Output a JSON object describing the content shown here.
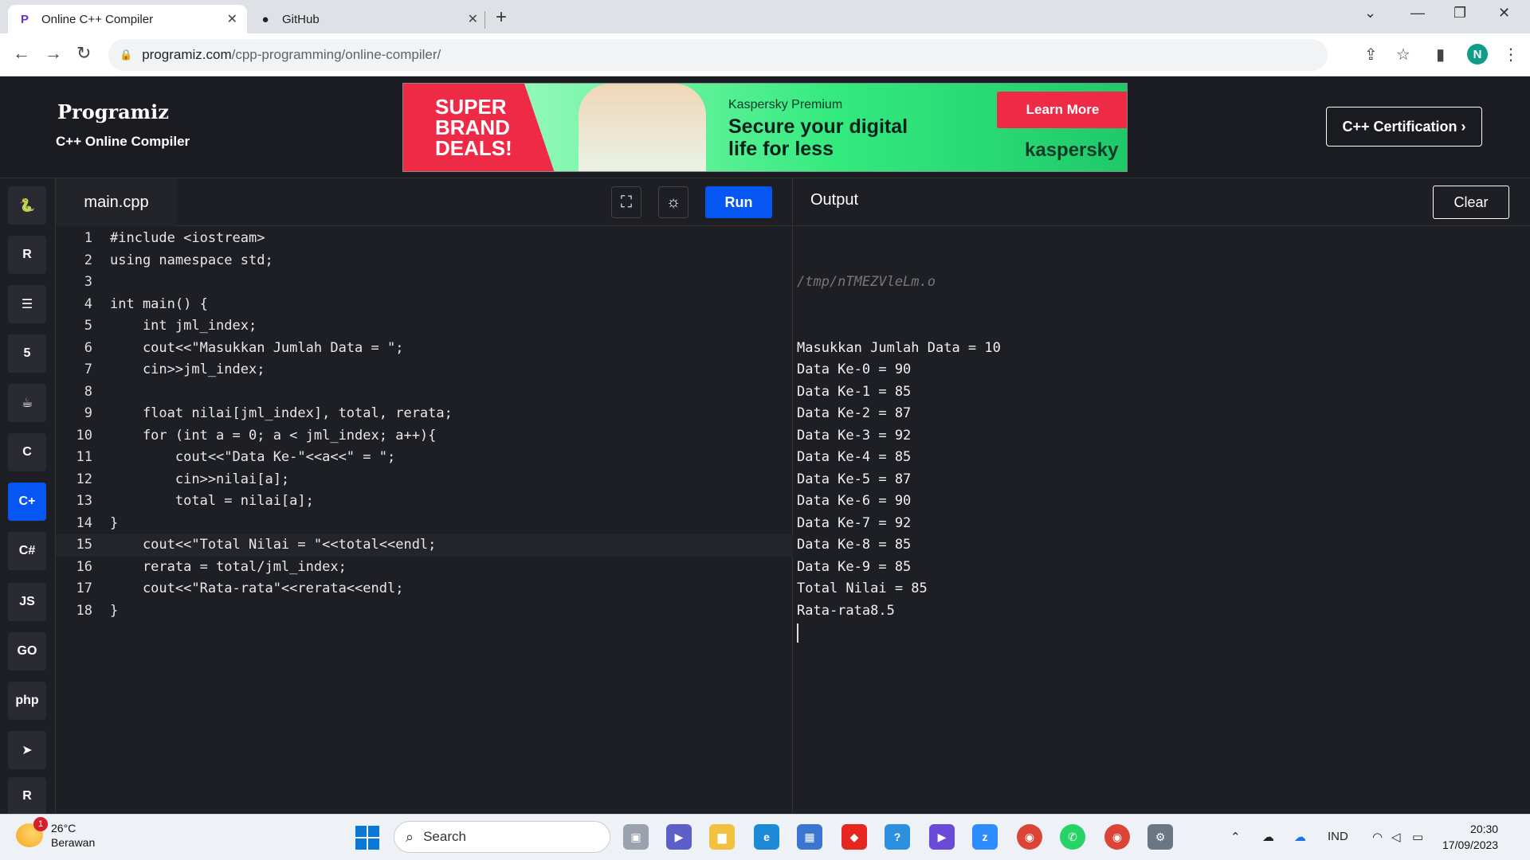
{
  "browser": {
    "tabs": [
      {
        "label": "Online C++ Compiler",
        "active": true
      },
      {
        "label": "GitHub",
        "active": false
      }
    ],
    "url_host": "programiz.com",
    "url_path": "/cpp-programming/online-compiler/",
    "profile_initial": "N"
  },
  "header": {
    "logo": "Programiz",
    "subtitle": "C++ Online Compiler",
    "cert_button": "C++ Certification ›"
  },
  "ad": {
    "deals": "SUPER\nBRAND\nDEALS!",
    "brand_line": "Kaspersky Premium",
    "headline": "Secure your digital\nlife for less",
    "button": "Learn More",
    "logo": "kaspersky"
  },
  "sidebar_langs": [
    {
      "name": "python-icon",
      "glyph": "🐍"
    },
    {
      "name": "r-icon",
      "glyph": "R"
    },
    {
      "name": "sql-icon",
      "glyph": "☰"
    },
    {
      "name": "html-icon",
      "glyph": "5"
    },
    {
      "name": "java-icon",
      "glyph": "☕"
    },
    {
      "name": "c-icon",
      "glyph": "C"
    },
    {
      "name": "cpp-icon",
      "glyph": "C+",
      "active": true
    },
    {
      "name": "csharp-icon",
      "glyph": "C#"
    },
    {
      "name": "js-icon",
      "glyph": "JS"
    },
    {
      "name": "go-icon",
      "glyph": "GO"
    },
    {
      "name": "php-icon",
      "glyph": "php"
    },
    {
      "name": "swift-icon",
      "glyph": "➤"
    },
    {
      "name": "rust-icon",
      "glyph": "R"
    }
  ],
  "editor": {
    "filename": "main.cpp",
    "run_label": "Run",
    "lines": [
      {
        "n": "1",
        "code": "#include <iostream>"
      },
      {
        "n": "2",
        "code": "using namespace std;"
      },
      {
        "n": "3",
        "code": ""
      },
      {
        "n": "4",
        "code": "int main() {"
      },
      {
        "n": "5",
        "code": "    int jml_index;"
      },
      {
        "n": "6",
        "code": "    cout<<\"Masukkan Jumlah Data = \";"
      },
      {
        "n": "7",
        "code": "    cin>>jml_index;"
      },
      {
        "n": "8",
        "code": ""
      },
      {
        "n": "9",
        "code": "    float nilai[jml_index], total, rerata;"
      },
      {
        "n": "10",
        "code": "    for (int a = 0; a < jml_index; a++){"
      },
      {
        "n": "11",
        "code": "        cout<<\"Data Ke-\"<<a<<\" = \";"
      },
      {
        "n": "12",
        "code": "        cin>>nilai[a];"
      },
      {
        "n": "13",
        "code": "        total = nilai[a];"
      },
      {
        "n": "14",
        "code": "}"
      },
      {
        "n": "15",
        "code": "    cout<<\"Total Nilai = \"<<total<<endl;",
        "highlight": true
      },
      {
        "n": "16",
        "code": "    rerata = total/jml_index;"
      },
      {
        "n": "17",
        "code": "    cout<<\"Rata-rata\"<<rerata<<endl;"
      },
      {
        "n": "18",
        "code": "}"
      }
    ]
  },
  "output": {
    "title": "Output",
    "clear_label": "Clear",
    "path": "/tmp/nTMEZVleLm.o",
    "lines": [
      "Masukkan Jumlah Data = 10",
      "Data Ke-0 = 90",
      "Data Ke-1 = 85",
      "Data Ke-2 = 87",
      "Data Ke-3 = 92",
      "Data Ke-4 = 85",
      "Data Ke-5 = 87",
      "Data Ke-6 = 90",
      "Data Ke-7 = 92",
      "Data Ke-8 = 85",
      "Data Ke-9 = 85",
      "Total Nilai = 85",
      "Rata-rata8.5"
    ]
  },
  "taskbar": {
    "weather_temp": "26°C",
    "weather_desc": "Berawan",
    "weather_badge": "1",
    "search_placeholder": "Search",
    "lang": "IND",
    "time": "20:30",
    "date": "17/09/2023"
  }
}
